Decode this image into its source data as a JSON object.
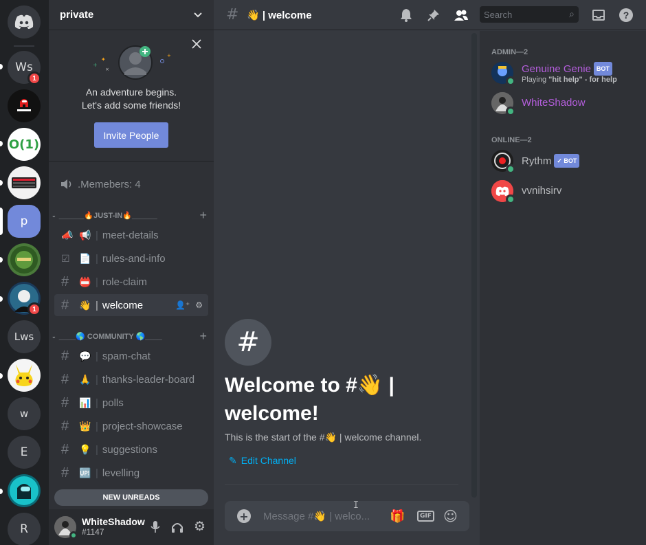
{
  "servers": [
    {
      "label": "",
      "icon": "discord-logo-icon",
      "type": "home"
    },
    {
      "label": "Ws",
      "badge": "1"
    },
    {
      "label": "",
      "icon": "among-us-server-icon"
    },
    {
      "label": "O(1)"
    },
    {
      "label": "",
      "icon": "keyboard-server-icon"
    },
    {
      "label": "p",
      "selected": true
    },
    {
      "label": "",
      "icon": "green-crest-server-icon"
    },
    {
      "label": "",
      "icon": "avatar-server-icon",
      "badge": "1"
    },
    {
      "label": "Lws"
    },
    {
      "label": "",
      "icon": "pikachu-server-icon"
    },
    {
      "label": "w"
    },
    {
      "label": "E"
    },
    {
      "label": "",
      "icon": "among-us-character-server-icon"
    },
    {
      "label": "R"
    }
  ],
  "server_header": {
    "name": "private"
  },
  "promo": {
    "line1": "An adventure begins.",
    "line2": "Let's add some friends!",
    "invite_label": "Invite People"
  },
  "voice_channel": {
    "name": ".Memebers: 4"
  },
  "categories": [
    {
      "label": "______🔥JUST-IN🔥______"
    },
    {
      "label": "____🌎 COMMUNITY 🌎____"
    }
  ],
  "channels": [
    {
      "emoji": "📢",
      "name": "meet-details"
    },
    {
      "emoji": "📄",
      "name": "rules-and-info"
    },
    {
      "emoji": "📛",
      "name": "role-claim"
    },
    {
      "emoji": "👋",
      "name": "welcome"
    },
    {
      "emoji": "💬",
      "name": "spam-chat"
    },
    {
      "emoji": "🙏",
      "name": "thanks-leader-board"
    },
    {
      "emoji": "📊",
      "name": "polls"
    },
    {
      "emoji": "👑",
      "name": "project-showcase"
    },
    {
      "emoji": "💡",
      "name": "suggestions"
    },
    {
      "emoji": "🆙",
      "name": "levelling"
    }
  ],
  "new_unreads": "NEW UNREADS",
  "user": {
    "name": "WhiteShadow",
    "tag": "#1147"
  },
  "topbar": {
    "channel_title": "👋 | welcome",
    "search_placeholder": "Search"
  },
  "welcome": {
    "title_line1": "Welcome to #👋 |",
    "title_line2": "welcome!",
    "subtitle": "This is the start of the #👋 | welcome channel.",
    "edit_label": "Edit Channel"
  },
  "composer": {
    "placeholder": "Message #👋 | welco...",
    "gif_label": "GIF"
  },
  "members": {
    "admin_header": "ADMIN—2",
    "online_header": "ONLINE—2",
    "admin": [
      {
        "name": "Genuine Genie",
        "bot": "BOT",
        "activity_prefix": "Playing ",
        "activity": "\"hit help\" - for help",
        "color": "#b45edc"
      },
      {
        "name": "WhiteShadow",
        "color": "#b45edc"
      }
    ],
    "online": [
      {
        "name": "Rythm",
        "bot": "✓ BOT",
        "color": "#b9bbbe"
      },
      {
        "name": "vvnihsirv",
        "color": "#b9bbbe"
      }
    ]
  },
  "colors": {
    "blurple": "#7289da",
    "online": "#43b581",
    "admin_role": "#b45edc",
    "link": "#00b0f4",
    "mention_badge": "#f04747"
  }
}
